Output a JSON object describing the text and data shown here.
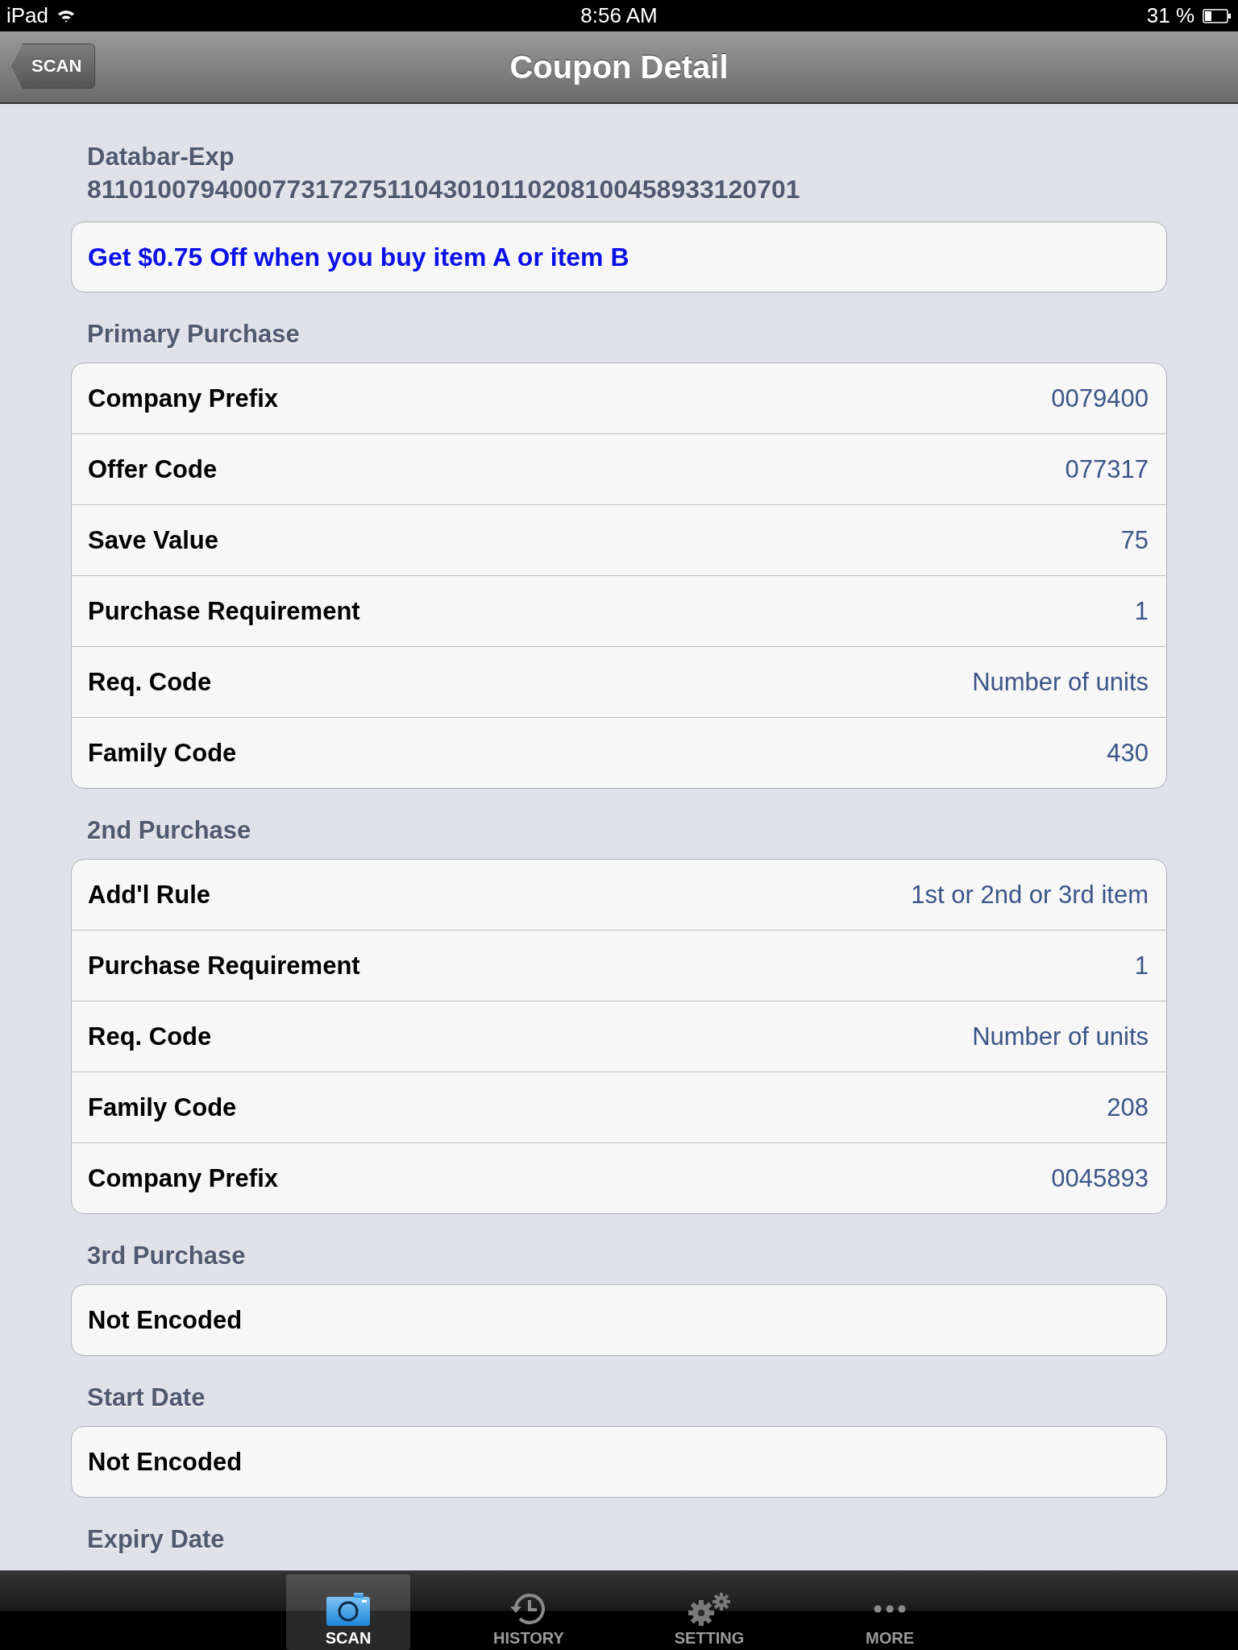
{
  "status_bar": {
    "carrier": "iPad",
    "time": "8:56 AM",
    "battery": "31 %"
  },
  "nav_bar": {
    "back": "SCAN",
    "title": "Coupon Detail"
  },
  "barcode": {
    "type": "Databar-Exp",
    "data": "81101007940007731727511043010110208100458933120701"
  },
  "offer": "Get $0.75 Off when you buy item A or item B",
  "sections": [
    {
      "title": "Primary Purchase",
      "rows": [
        {
          "label": "Company Prefix",
          "value": "0079400"
        },
        {
          "label": "Offer Code",
          "value": "077317"
        },
        {
          "label": "Save Value",
          "value": "75"
        },
        {
          "label": "Purchase Requirement",
          "value": "1"
        },
        {
          "label": "Req. Code",
          "value": "Number of units"
        },
        {
          "label": "Family Code",
          "value": "430"
        }
      ]
    },
    {
      "title": "2nd Purchase",
      "rows": [
        {
          "label": "Add'l Rule",
          "value": "1st or 2nd or 3rd item"
        },
        {
          "label": "Purchase Requirement",
          "value": "1"
        },
        {
          "label": "Req. Code",
          "value": "Number of units"
        },
        {
          "label": "Family Code",
          "value": "208"
        },
        {
          "label": "Company Prefix",
          "value": "0045893"
        }
      ]
    },
    {
      "title": "3rd Purchase",
      "rows": [
        {
          "label": "Not Encoded"
        }
      ]
    },
    {
      "title": "Start Date",
      "rows": [
        {
          "label": "Not Encoded"
        }
      ]
    },
    {
      "title": "Expiry Date"
    }
  ],
  "tabs": [
    {
      "label": "SCAN",
      "kind": "camera",
      "selected": true
    },
    {
      "label": "HISTORY",
      "kind": "clock",
      "selected": false
    },
    {
      "label": "SETTING",
      "kind": "gears",
      "selected": false
    },
    {
      "label": "MORE",
      "kind": "dots",
      "selected": false
    }
  ]
}
